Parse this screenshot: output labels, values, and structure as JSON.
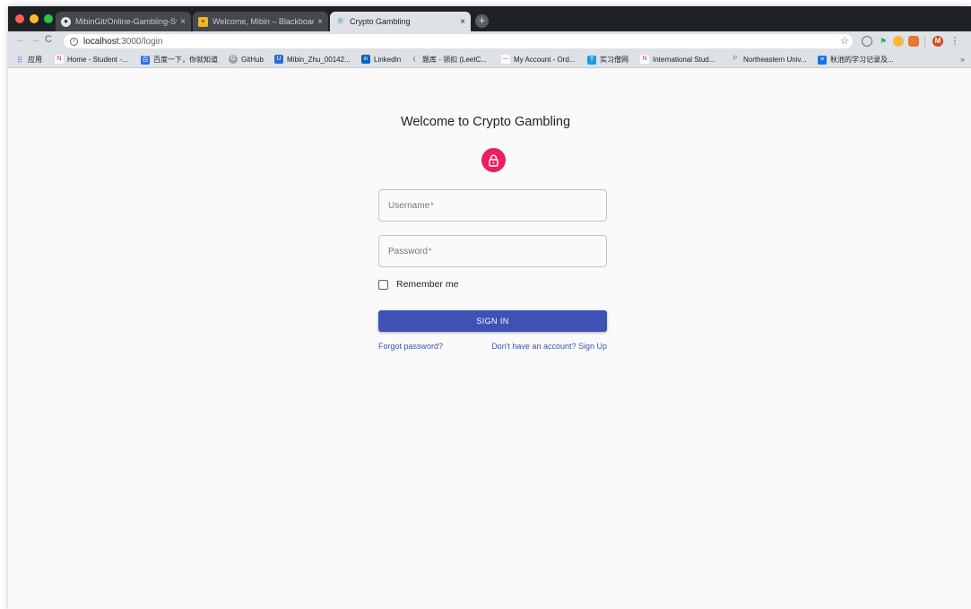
{
  "browser": {
    "tabs": [
      {
        "title": "MibinGit/Online-Gambling-Sys",
        "icon": "github-icon",
        "active": false
      },
      {
        "title": "Welcome, Mibin – Blackboard L",
        "icon": "blackboard-icon",
        "active": false
      },
      {
        "title": "Crypto Gambling",
        "icon": "react-icon",
        "active": true
      }
    ],
    "close_glyph": "×",
    "new_tab_glyph": "+",
    "nav": {
      "back": "←",
      "forward": "→",
      "reload": "C"
    },
    "url": {
      "host": "localhost",
      "path": ":3000/login"
    },
    "profile_initial": "M",
    "bookmarks_label_apps": "应用",
    "bookmarks": [
      {
        "label": "Home - Student -...",
        "color": "#d93025",
        "glyph": "N"
      },
      {
        "label": "百度一下，你就知道",
        "color": "#2f6fe0",
        "glyph": "百"
      },
      {
        "label": "GitHub",
        "color": "#9aa0a6",
        "glyph": "G"
      },
      {
        "label": "Mibin_Zhu_00142...",
        "color": "#2b6cd4",
        "glyph": "U"
      },
      {
        "label": "LinkedIn",
        "color": "#0a66c2",
        "glyph": "in"
      },
      {
        "label": "题库 - 领扣 (LeetC...",
        "color": "#333333",
        "glyph": "⟨"
      },
      {
        "label": "My Account - Ord...",
        "color": "#e5352b",
        "glyph": "—"
      },
      {
        "label": "实习僧网",
        "color": "#1a9be6",
        "glyph": "T"
      },
      {
        "label": "International Stud...",
        "color": "#d93025",
        "glyph": "N"
      },
      {
        "label": "Northeastern Univ...",
        "color": "#5aa02c",
        "glyph": "P"
      },
      {
        "label": "秋池的学习记录及...",
        "color": "#1a73e8",
        "glyph": "≡"
      }
    ],
    "bookmarks_more": "»"
  },
  "login": {
    "heading": "Welcome to Crypto Gambling",
    "username_placeholder": "Username",
    "password_placeholder": "Password",
    "required_mark": "*",
    "remember_label": "Remember me",
    "remember_checked": false,
    "signin_label": "SIGN IN",
    "forgot_link": "Forgot password?",
    "signup_link": "Don't have an account? Sign Up",
    "colors": {
      "primary": "#3f51b5",
      "lock_avatar": "#e91e63"
    }
  }
}
